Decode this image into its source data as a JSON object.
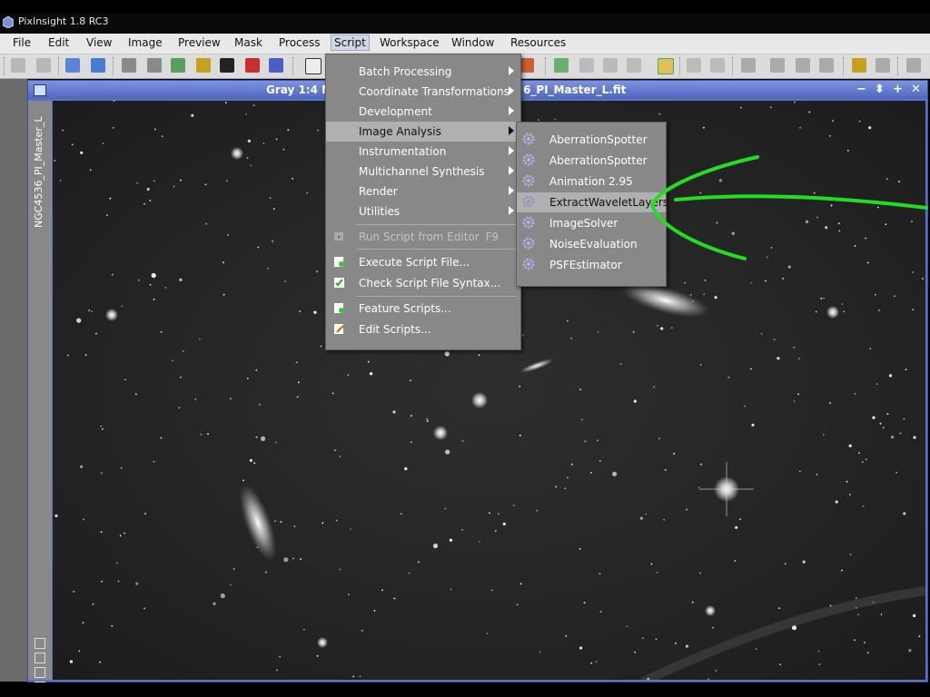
{
  "app": {
    "title": "PixInsight 1.8 RC3"
  },
  "menubar": {
    "items": [
      "File",
      "Edit",
      "View",
      "Image",
      "Preview",
      "Mask",
      "Process",
      "Script",
      "Workspace",
      "Window",
      "Resources"
    ],
    "active": "Script"
  },
  "image_window": {
    "title_left": "Gray 1:4 N",
    "title_right": "6_PI_Master_L.fit",
    "vertical_tab": "NGC4536_PI_Master_L",
    "controls": [
      "−",
      "⬍",
      "+",
      "✕"
    ]
  },
  "script_menu": {
    "items": [
      {
        "label": "Batch Processing",
        "submenu": true
      },
      {
        "label": "Coordinate Transformations",
        "submenu": true
      },
      {
        "label": "Development",
        "submenu": true
      },
      {
        "label": "Image Analysis",
        "submenu": true,
        "highlighted": true
      },
      {
        "label": "Instrumentation",
        "submenu": true
      },
      {
        "label": "Multichannel Synthesis",
        "submenu": true
      },
      {
        "label": "Render",
        "submenu": true
      },
      {
        "label": "Utilities",
        "submenu": true
      },
      {
        "label": "Run Script from Editor",
        "shortcut": "F9",
        "disabled": true,
        "icon": "run-script-icon"
      },
      {
        "label": "Execute Script File...",
        "icon": "execute-script-icon"
      },
      {
        "label": "Check Script File Syntax...",
        "icon": "check-syntax-icon"
      },
      {
        "label": "Feature Scripts...",
        "icon": "feature-scripts-icon"
      },
      {
        "label": "Edit Scripts...",
        "icon": "edit-scripts-icon"
      }
    ]
  },
  "image_analysis_submenu": {
    "items": [
      {
        "label": "AberrationSpotter",
        "icon": "gear-icon"
      },
      {
        "label": "AberrationSpotter",
        "icon": "gear-icon"
      },
      {
        "label": "Animation 2.95",
        "icon": "gear-icon"
      },
      {
        "label": "ExtractWaveletLayers",
        "icon": "gear-icon",
        "highlighted": true
      },
      {
        "label": "ImageSolver",
        "icon": "gear-icon"
      },
      {
        "label": "NoiseEvaluation",
        "icon": "gear-icon"
      },
      {
        "label": "PSFEstimator",
        "icon": "gear-icon"
      }
    ]
  },
  "annotation": {
    "color": "#22dd22",
    "shape": "arrow pointing at ExtractWaveletLayers"
  }
}
